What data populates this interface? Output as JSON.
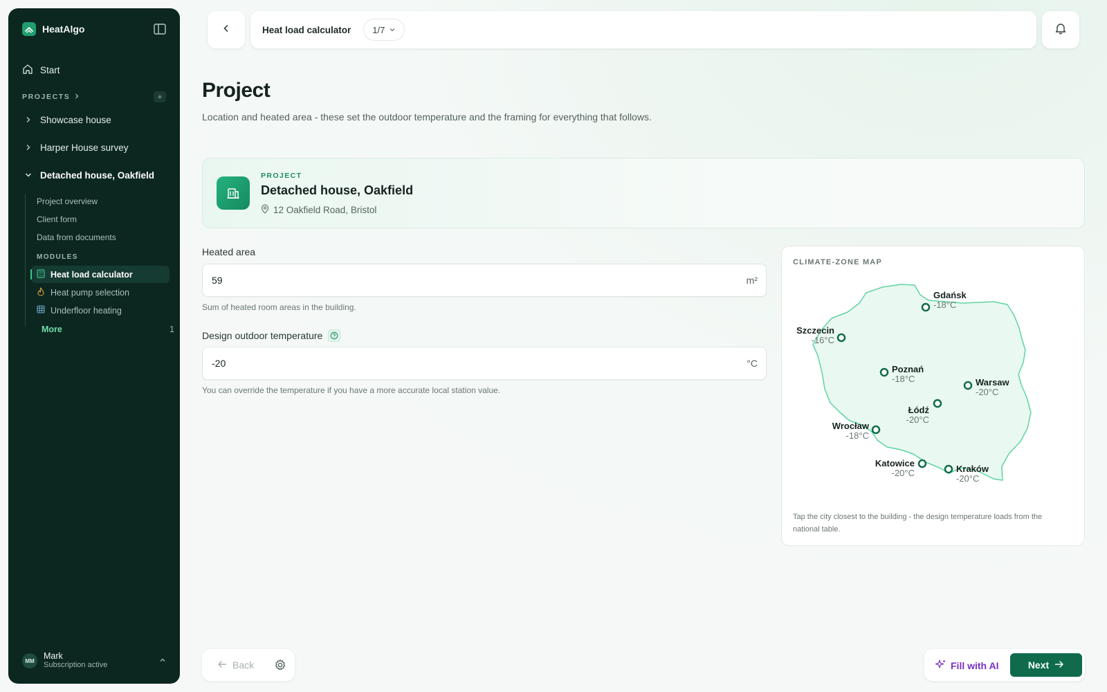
{
  "app": {
    "name": "HeatAlgo"
  },
  "sidebar": {
    "start_label": "Start",
    "projects_label": "PROJECTS",
    "add_label": "+",
    "projects": [
      {
        "label": "Showcase house"
      },
      {
        "label": "Harper House survey"
      },
      {
        "label": "Detached house, Oakfield"
      }
    ],
    "sub_items": [
      {
        "label": "Project overview"
      },
      {
        "label": "Client form"
      },
      {
        "label": "Data from documents"
      }
    ],
    "modules_label": "MODULES",
    "modules": [
      {
        "label": "Heat load calculator",
        "icon": "calculator-icon"
      },
      {
        "label": "Heat pump selection",
        "icon": "flame-icon"
      },
      {
        "label": "Underfloor heating",
        "icon": "grid-icon"
      }
    ],
    "more_label": "More",
    "more_count": "1",
    "user": {
      "initials": "MM",
      "name": "Mark",
      "status": "Subscription active"
    }
  },
  "topbar": {
    "title": "Heat load calculator",
    "step": "1/7"
  },
  "page": {
    "title": "Project",
    "subtitle": "Location and heated area - these set the outdoor temperature and the framing for everything that follows."
  },
  "project_card": {
    "tag": "PROJECT",
    "name": "Detached house, Oakfield",
    "address": "12 Oakfield Road, Bristol"
  },
  "heated_area": {
    "label": "Heated area",
    "value": "59",
    "unit": "m²",
    "help": "Sum of heated room areas in the building."
  },
  "design_temp": {
    "label": "Design outdoor temperature",
    "value": "-20",
    "unit": "°C",
    "help": "You can override the temperature if you have a more accurate local station value."
  },
  "map": {
    "title": "CLIMATE-ZONE MAP",
    "note": "Tap the city closest to the building - the design temperature loads from the national table.",
    "cities": [
      {
        "name": "Gdańsk",
        "temp": "-18°C"
      },
      {
        "name": "Szczecin",
        "temp": "-16°C"
      },
      {
        "name": "Poznań",
        "temp": "-18°C"
      },
      {
        "name": "Warsaw",
        "temp": "-20°C"
      },
      {
        "name": "Łódź",
        "temp": "-20°C"
      },
      {
        "name": "Wrocław",
        "temp": "-18°C"
      },
      {
        "name": "Katowice",
        "temp": "-20°C"
      },
      {
        "name": "Kraków",
        "temp": "-20°C"
      }
    ]
  },
  "footer": {
    "back_label": "Back",
    "ai_label": "Fill with AI",
    "next_label": "Next"
  },
  "colors": {
    "accent": "#0f6b4b",
    "sidebar": "#0c2620",
    "ai": "#7a2fc4"
  }
}
